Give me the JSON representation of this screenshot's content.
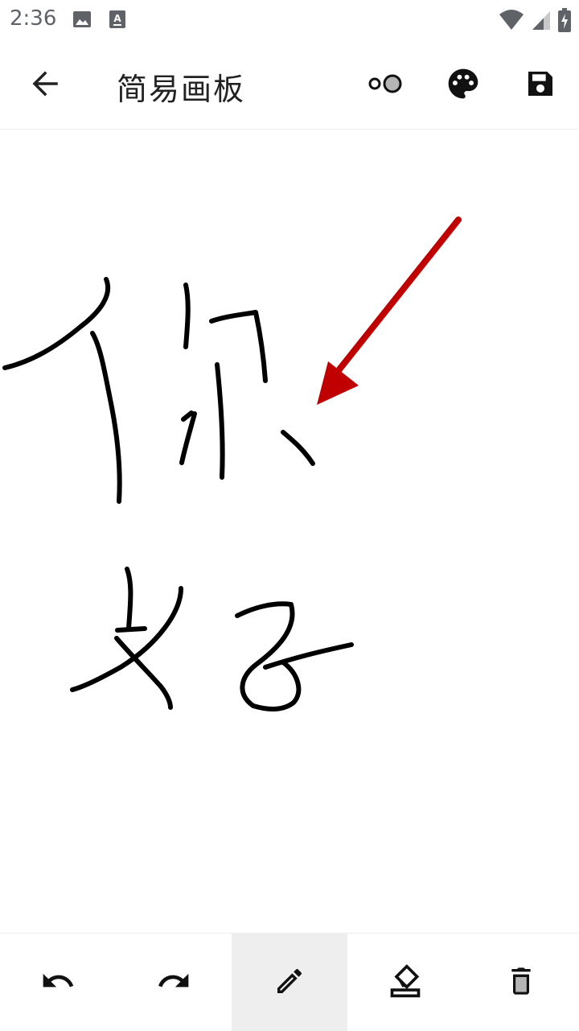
{
  "status_bar": {
    "time": "2:36",
    "left_icons": [
      "image-icon",
      "font-download-icon"
    ],
    "right_icons": [
      "wifi-icon",
      "signal-icon",
      "battery-charging-icon"
    ]
  },
  "app_bar": {
    "title": "简易画板",
    "icons": [
      "back-arrow-icon",
      "stroke-size-icon",
      "palette-icon",
      "save-icon"
    ]
  },
  "canvas": {
    "ink_color": "#000000",
    "arrow_color": "#c00000",
    "handwriting": [
      "你",
      "好"
    ]
  },
  "toolbar": {
    "tools": [
      "undo-icon",
      "redo-icon",
      "pencil-icon",
      "eraser-icon",
      "delete-icon"
    ],
    "active_tool": "pencil"
  }
}
